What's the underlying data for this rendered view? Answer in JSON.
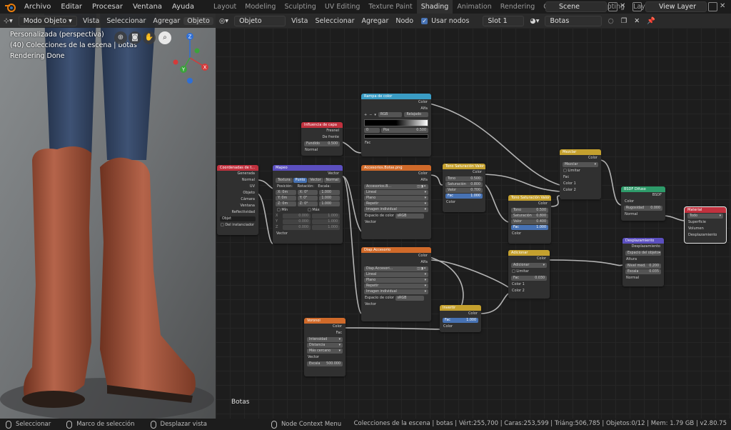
{
  "menu": [
    "Archivo",
    "Editar",
    "Procesar",
    "Ventana",
    "Ayuda"
  ],
  "workspaces": [
    {
      "label": "Layout",
      "active": false
    },
    {
      "label": "Modeling",
      "active": false
    },
    {
      "label": "Sculpting",
      "active": false
    },
    {
      "label": "UV Editing",
      "active": false
    },
    {
      "label": "Texture Paint",
      "active": false
    },
    {
      "label": "Shading",
      "active": true
    },
    {
      "label": "Animation",
      "active": false
    },
    {
      "label": "Rendering",
      "active": false
    },
    {
      "label": "Compositing",
      "active": false
    },
    {
      "label": "Scripting",
      "active": false
    },
    {
      "label": "Layout",
      "active": false
    }
  ],
  "scene": "Scene",
  "view_layer": "View Layer",
  "viewport": {
    "mode": "Modo Objeto",
    "menus": [
      "Vista",
      "Seleccionar",
      "Agregar",
      "Objeto"
    ],
    "overlay_lines": [
      "Personalizada (perspectiva)",
      "(40) Colecciones de la escena | botas",
      "Rendering Done"
    ],
    "gizmo_axes": {
      "x": "X",
      "y": "Y",
      "z": "Z"
    }
  },
  "node_editor": {
    "type": "Objeto",
    "menus": [
      "Vista",
      "Seleccionar",
      "Agregar",
      "Nodo"
    ],
    "use_nodes_label": "Usar nodos",
    "slot": "Slot 1",
    "material": "Botas",
    "label": "Botas"
  },
  "nodes": {
    "texcoord": {
      "title": "Coordenadas de t...",
      "outputs": [
        "Generada",
        "Normal",
        "UV",
        "Objeto",
        "Cámara",
        "Ventana",
        "Reflectividad"
      ],
      "object_label": "Objet",
      "instancer": "Del instanciador"
    },
    "layer_weight": {
      "title": "Influencia de capa",
      "outputs": [
        "Fresnel",
        "De frente"
      ],
      "blend_label": "Fundido",
      "blend_value": "0.500",
      "normal": "Normal"
    },
    "mapping": {
      "title": "Mapeo",
      "output": "Vector",
      "tabs": [
        "Textura",
        "Punto",
        "Vector",
        "Normal"
      ],
      "col_headers": [
        "Posición:",
        "Rotación:",
        "Escala:"
      ],
      "rows": [
        [
          "X: 0m",
          "X: 0°",
          "1.000"
        ],
        [
          "Y: 0m",
          "Y: 0°",
          "1.000"
        ],
        [
          "Z: 0m",
          "Z: 0°",
          "1.000"
        ]
      ],
      "min_label": "Mín",
      "max_label": "Máx",
      "minmax": [
        [
          "X",
          "0.000",
          "1.000"
        ],
        [
          "Y",
          "0.000",
          "1.000"
        ],
        [
          "Z",
          "0.000",
          "1.000"
        ]
      ],
      "input": "Vector"
    },
    "color_ramp": {
      "title": "Rampa de color",
      "outputs": [
        "Color",
        "Alfa"
      ],
      "mode1": "RGB",
      "mode2": "Relajado",
      "index": "0",
      "pos_label": "Pos",
      "pos_value": "0.500",
      "input": "Fac"
    },
    "tex1": {
      "title": "Accesorios.Botas.png",
      "outputs": [
        "Color",
        "Alfa"
      ],
      "image": "Accesorios.B...",
      "options": [
        "Lineal",
        "Plano",
        "Repetir",
        "Imagen individual"
      ],
      "colorspace_label": "Espacio de color",
      "colorspace": "sRGB",
      "input": "Vector"
    },
    "tex2": {
      "title": "Diap.Accesorio",
      "outputs": [
        "Color",
        "Alfa"
      ],
      "image": "Diap.Accesori...",
      "options": [
        "Lineal",
        "Plano",
        "Repetir",
        "Imagen individual"
      ],
      "colorspace_label": "Espacio de color",
      "colorspace": "sRGB",
      "input": "Vector"
    },
    "hsv1": {
      "title": "Tono Saturación Valor",
      "output": "Color",
      "fields": [
        [
          "Tono",
          "0.500"
        ],
        [
          "Saturación",
          "0.800"
        ],
        [
          "Valor",
          "0.700"
        ]
      ],
      "fac": [
        "Fac",
        "1.000"
      ],
      "input": "Color"
    },
    "hsv2": {
      "title": "Tono Saturación Valor",
      "output": "Color",
      "fields": [
        [
          "Tono",
          "0.500"
        ],
        [
          "Saturación",
          "0.800"
        ],
        [
          "Valor",
          "0.400"
        ]
      ],
      "fac": [
        "Fac",
        "1.000"
      ],
      "input": "Color"
    },
    "mix1": {
      "title": "Mezclar",
      "output": "Color",
      "mode": "Mezclar",
      "clamp": "Limitar",
      "inputs": [
        "Fac",
        "Color 1",
        "Color 2"
      ]
    },
    "mix2": {
      "title": "Adicionar",
      "output": "Color",
      "mode": "Adicionar",
      "clamp": "Limitar",
      "fac": [
        "Fac",
        "0.030"
      ],
      "inputs": [
        "Color 1",
        "Color 2"
      ]
    },
    "bsdf": {
      "title": "BSDF Difuso",
      "output": "BSDF",
      "inputs": [
        "Color"
      ],
      "roughness": [
        "Rugosidad",
        "0.000"
      ],
      "normal": "Normal"
    },
    "output": {
      "title": "Material",
      "target": "Todo",
      "inputs": [
        "Superficie",
        "Volumen",
        "Desplazamiento"
      ]
    },
    "disp": {
      "title": "Desplazamiento",
      "output": "Desplazamiento",
      "space": "Espacio del objeto",
      "inputs": [
        "Altura"
      ],
      "midlevel": [
        "Nivel med.",
        "0.200"
      ],
      "scale": [
        "Escala",
        "0.035"
      ],
      "normal": "Normal"
    },
    "invert": {
      "title": "Invertir",
      "output": "Color",
      "fac": [
        "Fac",
        "1.000"
      ],
      "input": "Color"
    },
    "voronoi": {
      "title": "Voronoi",
      "outputs": [
        "Color",
        "Fac"
      ],
      "options": [
        "Intensidad",
        "Distancia",
        "Más cercano"
      ],
      "input": "Vector",
      "scale": [
        "Escala",
        "500.000"
      ]
    }
  },
  "statusbar": {
    "items": [
      "Seleccionar",
      "Marco de selección",
      "Desplazar vista",
      "Node Context Menu"
    ],
    "stats": "Colecciones de la escena | botas | Vért:255,700 | Caras:253,599 | Triáng:506,785 | Objetos:0/12 | Mem: 1.79 GB | v2.80.75"
  },
  "colors": {
    "accent": "#4772b3",
    "input_node": "#c0313e",
    "texture_node": "#d06a2a",
    "color_node": "#c4a02e",
    "vector_node": "#5b4fbf",
    "shader_node": "#2e9b6a",
    "converter_node": "#3a9cc4",
    "output_node": "#c0313e"
  }
}
